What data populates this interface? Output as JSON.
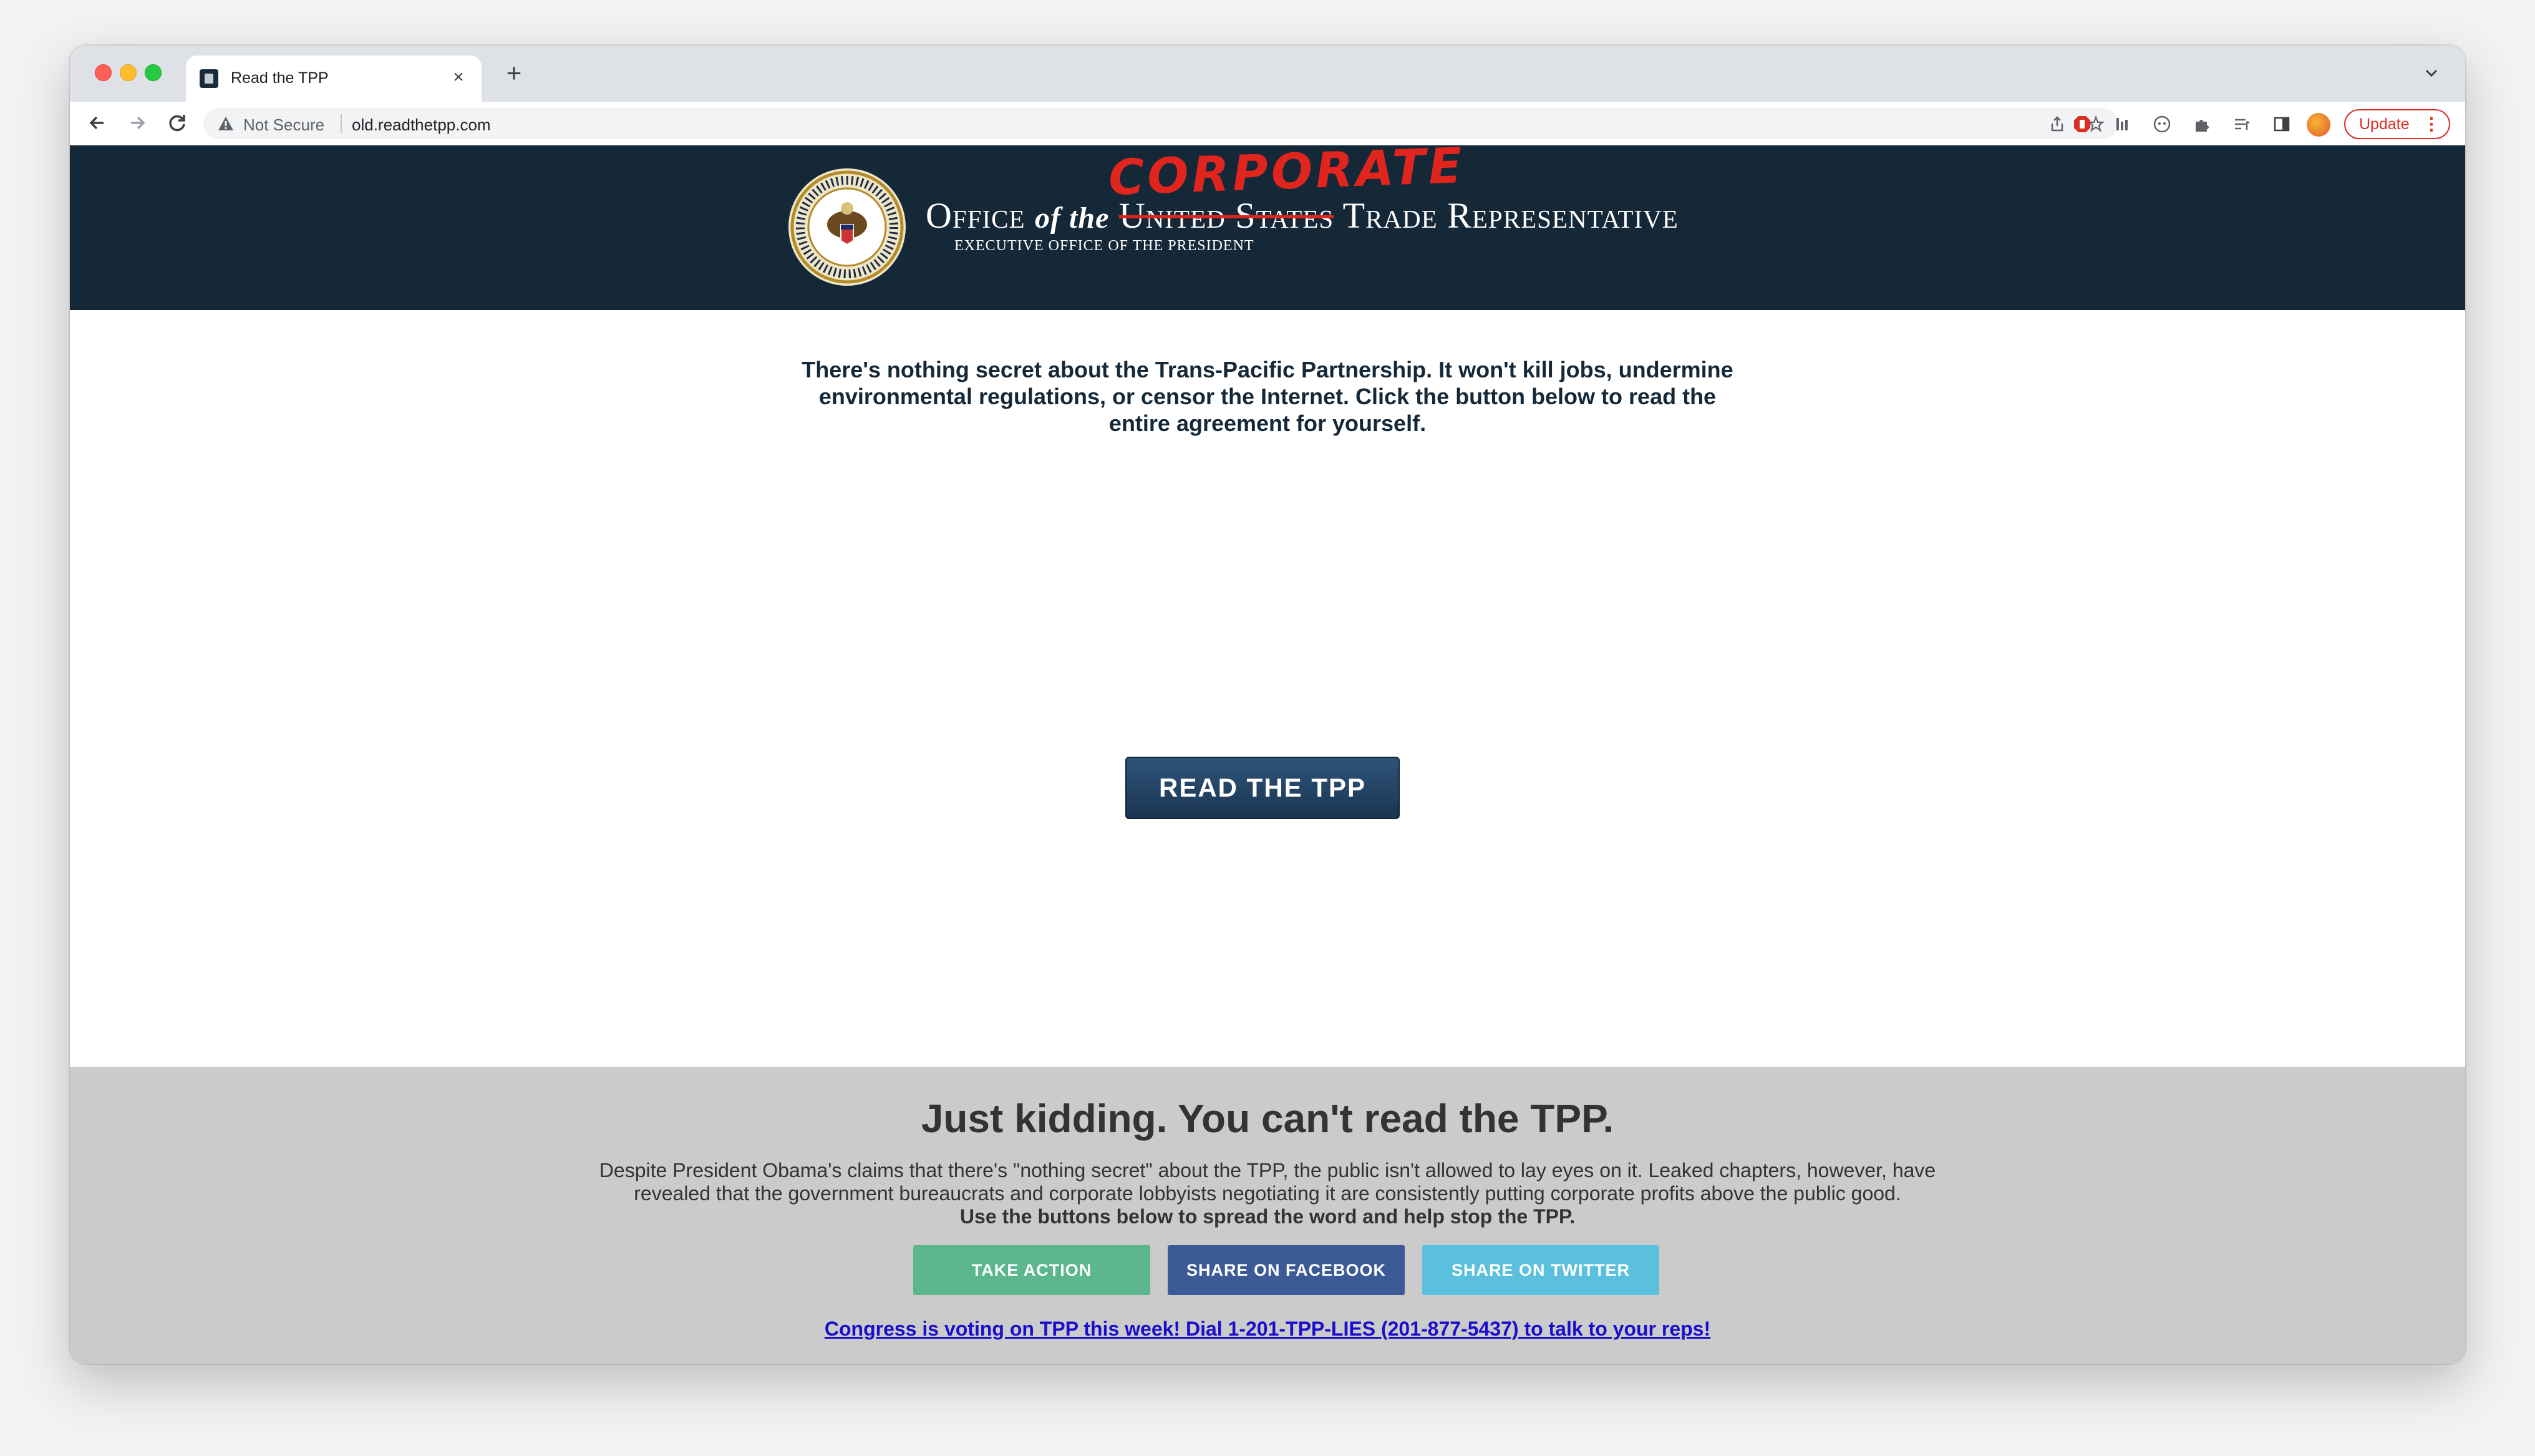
{
  "browser": {
    "tab_title": "Read the TPP",
    "tab_close": "×",
    "new_tab": "+",
    "security_label": "Not Secure",
    "url": "old.readthetpp.com",
    "update_label": "Update",
    "menu_dots": "⋮"
  },
  "header": {
    "office": "Office",
    "of_the": "of the",
    "struck_text": "United States",
    "corporate": "CORPORATE",
    "trade_rep": "Trade Representative",
    "subtitle": "EXECUTIVE OFFICE OF THE PRESIDENT"
  },
  "main": {
    "intro": "There's nothing secret about the Trans-Pacific Partnership. It won't kill jobs, undermine environmental regulations, or censor the Internet. Click the button below to read the entire agreement for yourself.",
    "read_button": "READ THE TPP"
  },
  "footer": {
    "headline": "Just kidding. You can't read the TPP.",
    "description": "Despite President Obama's claims that there's \"nothing secret\" about the TPP, the public isn't allowed to lay eyes on it. Leaked chapters, however, have revealed that the government bureaucrats and corporate lobbyists negotiating it are consistently putting corporate profits above the public good.",
    "call_to_action": "Use the buttons below to spread the word and help stop the TPP.",
    "buttons": {
      "take_action": "TAKE ACTION",
      "share_facebook": "SHARE ON FACEBOOK",
      "share_twitter": "SHARE ON TWITTER"
    },
    "congress_link": "Congress is voting on TPP this week! Dial 1-201-TPP-LIES (201-877-5437) to talk to your reps!"
  },
  "colors": {
    "header_bg": "#152838",
    "corporate_red": "#e0251e",
    "take_action": "#5cb78e",
    "facebook": "#3b5a96",
    "twitter": "#5bc0de",
    "link": "#1a0dcc"
  }
}
